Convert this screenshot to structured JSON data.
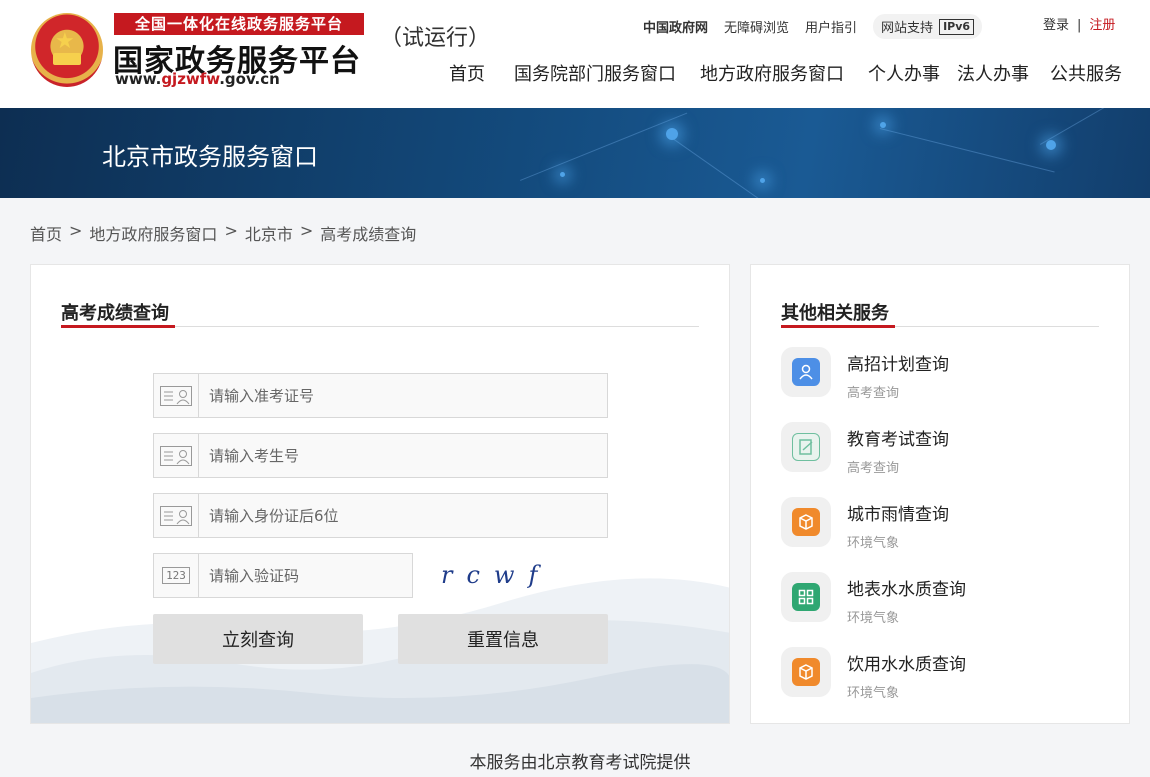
{
  "header": {
    "brand_top": "全国一体化在线政务服务平台",
    "brand_main": "国家政务服务平台",
    "brand_url_pre": "www.",
    "brand_url_mid": "gjzwfw",
    "brand_url_post": ".gov.cn",
    "trial": "（试运行）",
    "top_links": {
      "gov": "中国政府网",
      "accessible": "无障碍浏览",
      "guide": "用户指引",
      "ipv6_label": "网站支持",
      "ipv6_badge": "IPv6"
    },
    "auth": {
      "login": "登录",
      "sep": "|",
      "register": "注册"
    },
    "nav": [
      "首页",
      "国务院部门服务窗口",
      "地方政府服务窗口",
      "个人办事",
      "法人办事",
      "公共服务"
    ]
  },
  "banner": {
    "title": "北京市政务服务窗口"
  },
  "breadcrumb": [
    "首页",
    "地方政府服务窗口",
    "北京市",
    "高考成绩查询"
  ],
  "breadcrumb_sep": ">",
  "query_panel": {
    "title": "高考成绩查询",
    "fields": [
      {
        "placeholder": "请输入准考证号",
        "icon": "id-card-icon"
      },
      {
        "placeholder": "请输入考生号",
        "icon": "id-card-icon"
      },
      {
        "placeholder": "请输入身份证后6位",
        "icon": "id-card-icon"
      }
    ],
    "captcha_field": {
      "placeholder": "请输入验证码",
      "icon_text": "123"
    },
    "captcha_text": "rcwf",
    "submit_label": "立刻查询",
    "reset_label": "重置信息"
  },
  "related": {
    "title": "其他相关服务",
    "items": [
      {
        "name": "高招计划查询",
        "category": "高考查询",
        "icon": "person-icon",
        "color": "#4d8fe6"
      },
      {
        "name": "教育考试查询",
        "category": "高考查询",
        "icon": "notebook-icon",
        "color": "#6fbf9f"
      },
      {
        "name": "城市雨情查询",
        "category": "环境气象",
        "icon": "cube-icon",
        "color": "#f08a2c"
      },
      {
        "name": "地表水水质查询",
        "category": "环境气象",
        "icon": "grid-icon",
        "color": "#2fa772"
      },
      {
        "name": "饮用水水质查询",
        "category": "环境气象",
        "icon": "cube-icon",
        "color": "#f08a2c"
      }
    ]
  },
  "footer_note": "本服务由北京教育考试院提供",
  "colors": {
    "accent_red": "#c5191f",
    "banner_blue": "#134a7c"
  }
}
